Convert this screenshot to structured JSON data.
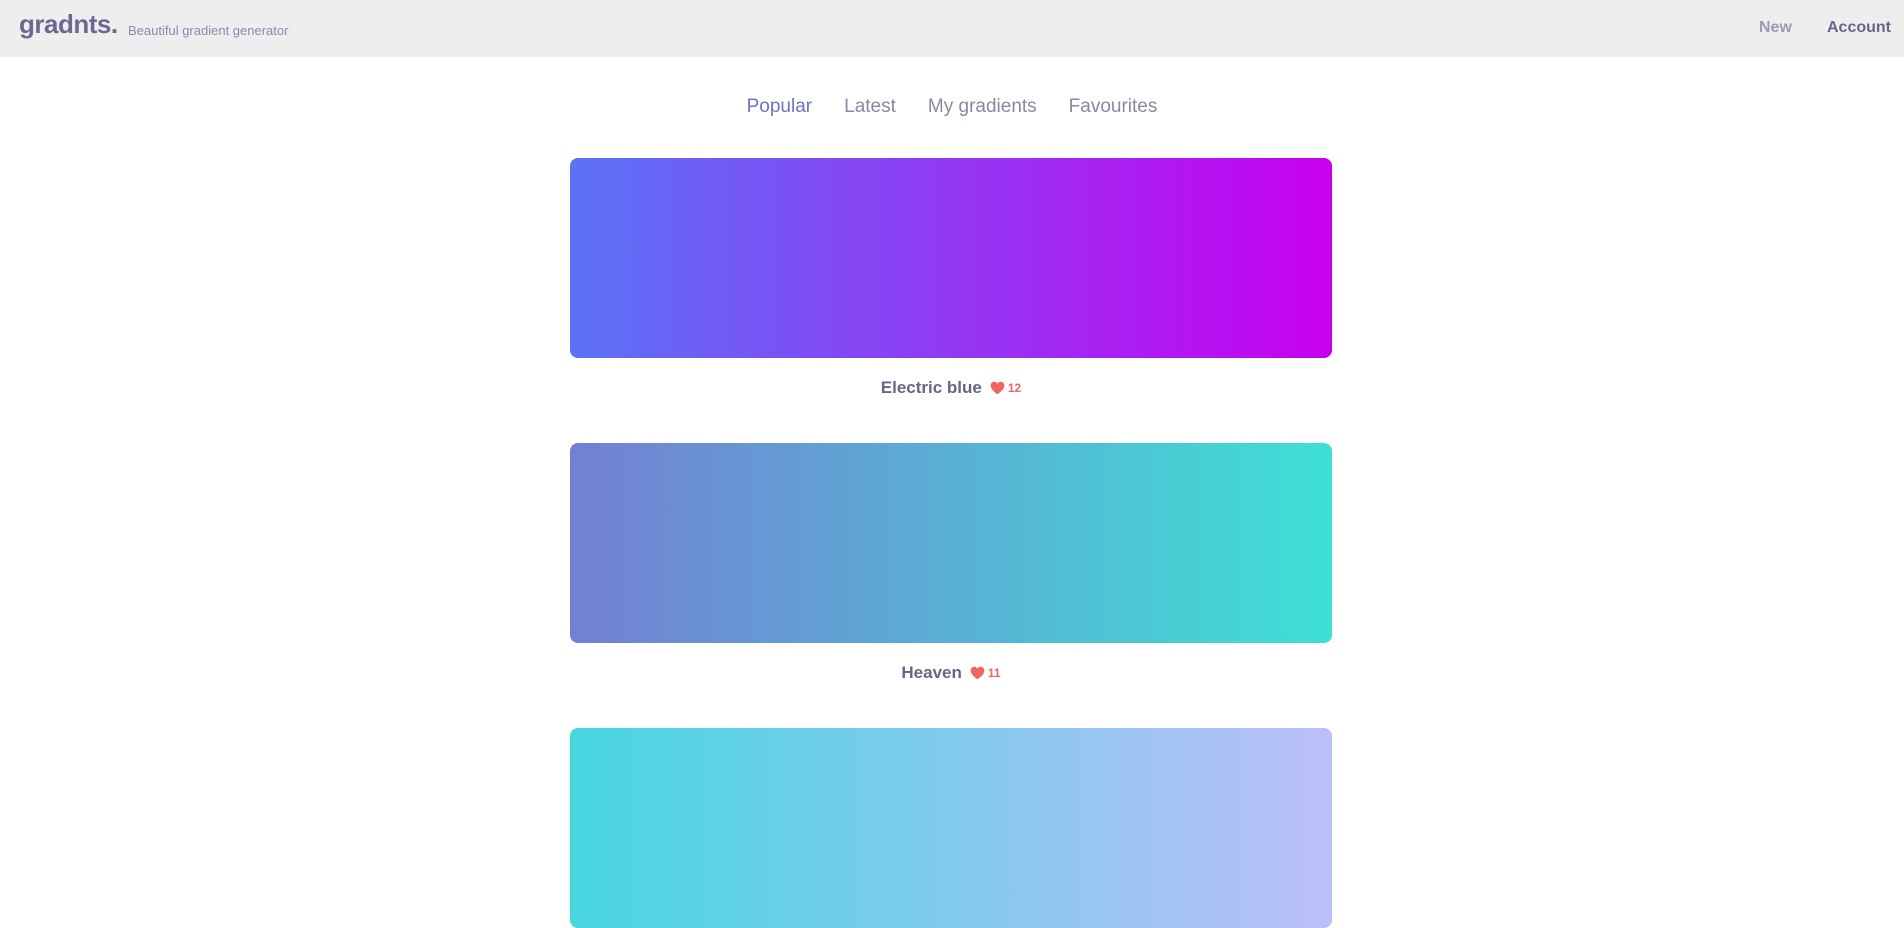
{
  "header": {
    "logo": "gradnts.",
    "tagline": "Beautiful gradient generator",
    "nav": {
      "new": "New",
      "account": "Account"
    }
  },
  "tabs": [
    {
      "label": "Popular",
      "active": true
    },
    {
      "label": "Latest",
      "active": false
    },
    {
      "label": "My gradients",
      "active": false
    },
    {
      "label": "Favourites",
      "active": false
    }
  ],
  "gradients": [
    {
      "name": "Electric blue",
      "likes": "12",
      "colors": [
        "#5b72f6",
        "#c800ef"
      ]
    },
    {
      "name": "Heaven",
      "likes": "11",
      "colors": [
        "#747fd3",
        "#3ee0d5"
      ]
    },
    {
      "name": "",
      "likes": "",
      "colors": [
        "#47d6df",
        "#bcbefa"
      ]
    }
  ],
  "icons": {
    "like": "heart-icon"
  },
  "colors": {
    "heart": "#f06464",
    "accent": "#6d72cc"
  }
}
